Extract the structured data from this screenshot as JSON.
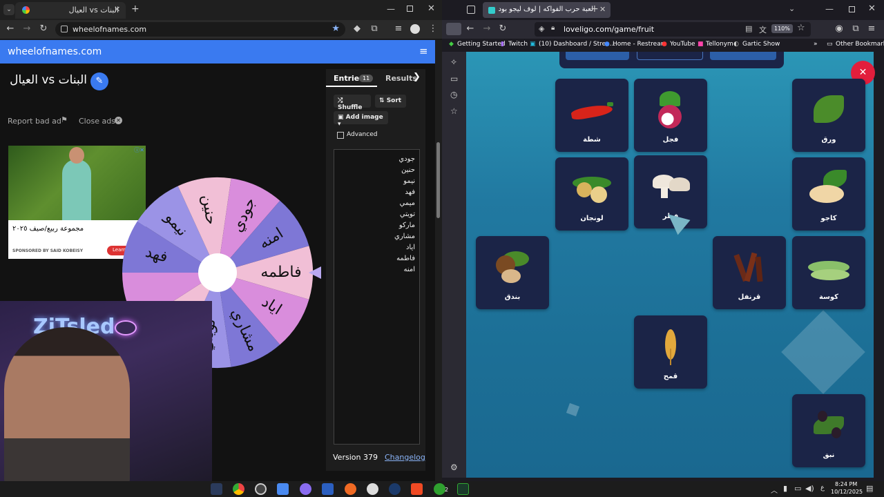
{
  "left_browser": {
    "tab_title": "البنات vs العيال",
    "url": "wheelofnames.com"
  },
  "wheel_site": {
    "logo": "wheelofnames.com",
    "wheel_title": "البنات vs العيال",
    "report_ad": "Report bad ad",
    "close_ads": "Close ads",
    "ad_caption": "مجموعة ربيع/صيف ٢٠٢٥",
    "ad_sponsor": "SPONSORED BY SAID KOBEISY",
    "ad_cta": "Learn",
    "tabs": {
      "entries": "Entries",
      "entries_count": "11",
      "results": "Results"
    },
    "buttons": {
      "shuffle": "Shuffle",
      "sort": "Sort",
      "add_image": "Add image",
      "advanced": "Advanced"
    },
    "entries": [
      "جودي",
      "حنين",
      "نيمو",
      "فهد",
      "ميمي",
      "تويتي",
      "ماركو",
      "مشاري",
      "اياد",
      "فاطمه",
      "امنه"
    ],
    "version": "Version 379",
    "changelog": "Changelog",
    "wheel_labels": [
      "جودي",
      "امنه",
      "فاطمه",
      "اياد",
      "مشاري",
      "تويتي",
      "فهد",
      "نيمو",
      "حنين"
    ],
    "colors": {
      "header": "#3a7af0",
      "pink": "#f1bfd6",
      "magenta": "#d98ddc",
      "indigo": "#7e77d6",
      "blue": "#9b93e6"
    }
  },
  "right_browser": {
    "tab_title": "لعبة حرب الفواكه | لوف ليجو بود",
    "url": "loveligo.com/game/fruit",
    "zoom": "110%",
    "bookmarks": [
      "Getting Started",
      "Twitch",
      "(10) Dashboard / Strea...",
      "Home - Restream",
      "YouTube",
      "Tellonym",
      "Gartic Show"
    ],
    "other_bookmarks": "Other Bookmarks"
  },
  "game": {
    "cards": {
      "chili": "شطة",
      "radish": "فجل",
      "leaf": "ورق",
      "longan": "لونجان",
      "mushroom": "فطر",
      "cashew": "كاجو",
      "hazelnut": "بندق",
      "clove": "قرنفل",
      "zucchini": "كوسة",
      "wheat": "قمح",
      "olive": "نبق"
    }
  },
  "taskbar": {
    "time": "8:24 PM",
    "date": "10/12/2025",
    "lang": "ع",
    "badge": "2"
  }
}
